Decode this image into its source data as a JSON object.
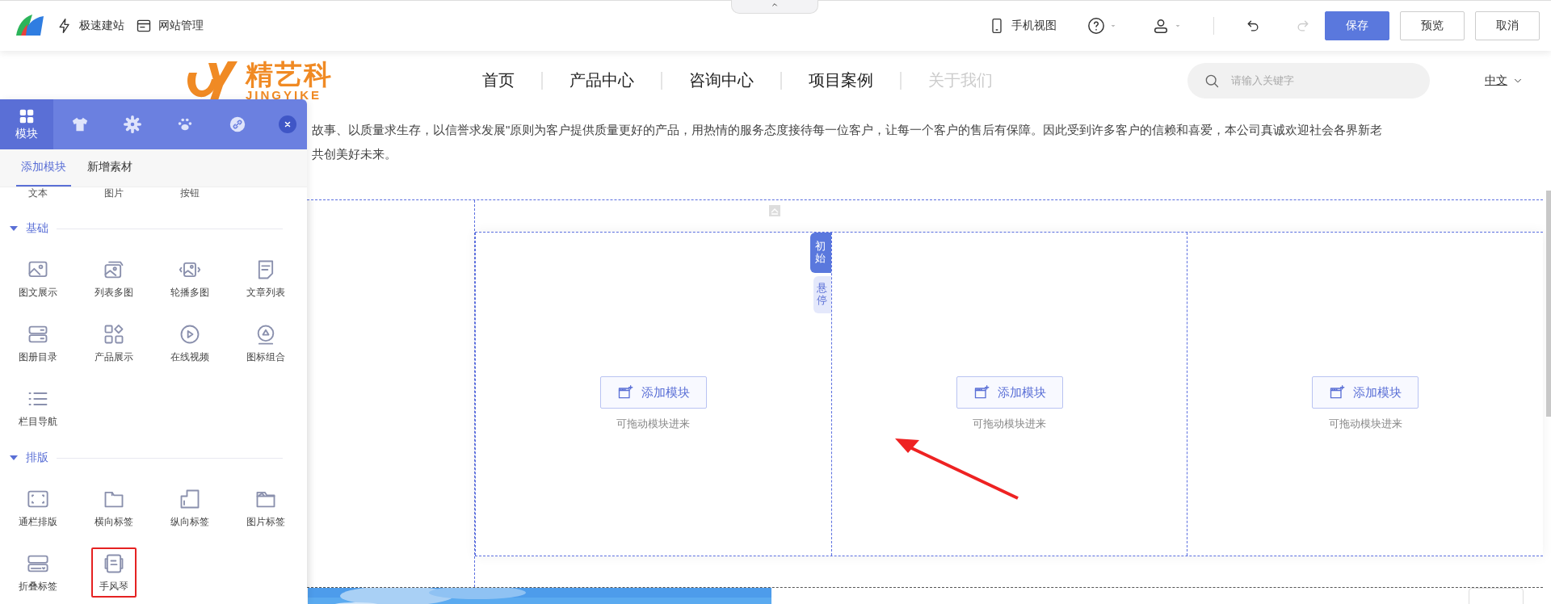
{
  "toolbar": {
    "left_items": [
      {
        "kind": "bolt",
        "label": "极速建站"
      },
      {
        "kind": "manage",
        "label": "网站管理"
      }
    ],
    "mobile_view": "手机视图",
    "redo_disabled": true,
    "buttons": [
      {
        "label": "保存",
        "primary": true
      },
      {
        "label": "预览",
        "primary": false
      },
      {
        "label": "取消",
        "primary": false
      }
    ]
  },
  "site_header": {
    "logo_text": "精艺科",
    "logo_subtext": "JINGYIKE",
    "nav": [
      {
        "label": "首页",
        "disabled": false
      },
      {
        "label": "产品中心",
        "disabled": false
      },
      {
        "label": "咨询中心",
        "disabled": false
      },
      {
        "label": "项目案例",
        "disabled": false
      },
      {
        "label": "关于我们",
        "disabled": true
      }
    ],
    "search": {
      "placeholder": "请输入关键字"
    },
    "language": "中文"
  },
  "intro": [
    "故事、以质量求生存，以信誉求发展\"原则为客户提供质量更好的产品，用热情的服务态度接待每一位客户，让每一个客户的售后有保障。因此受到许多客户的信赖和喜爱，本公司真诚欢迎社会各界新老",
    "共创美好未来。"
  ],
  "sidebar": {
    "tabs": [
      {
        "kind": "modules",
        "label": "模块",
        "selected": true
      },
      {
        "kind": "shirt",
        "selected": false
      },
      {
        "kind": "gear",
        "selected": false
      },
      {
        "kind": "paw",
        "selected": false
      },
      {
        "kind": "link",
        "selected": false
      }
    ],
    "subtabs": [
      {
        "label": "添加模块",
        "selected": true
      },
      {
        "label": "新增素材",
        "selected": false
      }
    ],
    "partial_items": [
      "文本",
      "图片",
      "按钮"
    ],
    "sections": [
      {
        "title": "基础",
        "expanded": true,
        "items": [
          {
            "kind": "image-text",
            "label": "图文展示",
            "highlighted": false
          },
          {
            "kind": "multi-image",
            "label": "列表多图",
            "highlighted": false
          },
          {
            "kind": "carousel",
            "label": "轮播多图",
            "highlighted": false
          },
          {
            "kind": "article",
            "label": "文章列表",
            "highlighted": false
          },
          {
            "kind": "album",
            "label": "图册目录",
            "highlighted": false
          },
          {
            "kind": "product",
            "label": "产品展示",
            "highlighted": false
          },
          {
            "kind": "video",
            "label": "在线视频",
            "highlighted": false
          },
          {
            "kind": "icon-group",
            "label": "图标组合",
            "highlighted": false
          },
          {
            "kind": "nav",
            "label": "栏目导航",
            "highlighted": false
          }
        ]
      },
      {
        "title": "排版",
        "expanded": true,
        "items": [
          {
            "kind": "banner",
            "label": "通栏排版",
            "highlighted": false
          },
          {
            "kind": "htab",
            "label": "横向标签",
            "highlighted": false
          },
          {
            "kind": "vtab",
            "label": "纵向标签",
            "highlighted": false
          },
          {
            "kind": "imgtab",
            "label": "图片标签",
            "highlighted": false
          },
          {
            "kind": "fold",
            "label": "折叠标签",
            "highlighted": false
          },
          {
            "kind": "accordion",
            "label": "手风琴",
            "highlighted": true
          }
        ]
      }
    ]
  },
  "canvas": {
    "state_tabs": [
      {
        "label": "初始",
        "selected": true
      },
      {
        "label": "悬停",
        "selected": false
      }
    ],
    "columns": [
      {
        "button": "添加模块",
        "hint": "可拖动模块进来"
      },
      {
        "button": "添加模块",
        "hint": "可拖动模块进来"
      },
      {
        "button": "添加模块",
        "hint": "可拖动模块进来"
      }
    ]
  }
}
